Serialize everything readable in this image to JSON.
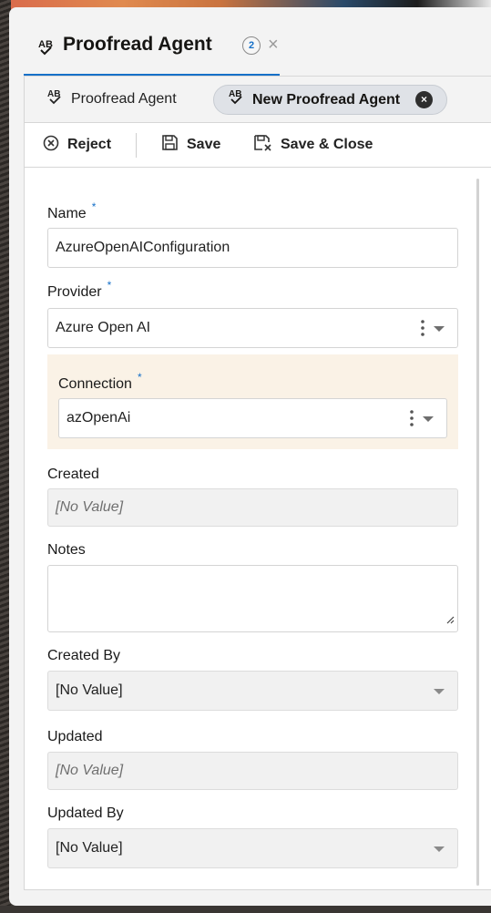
{
  "header": {
    "title": "Proofread Agent",
    "count": "2",
    "close_glyph": "×"
  },
  "subtabs": [
    {
      "label": "Proofread Agent"
    },
    {
      "label": "New Proofread Agent",
      "close_glyph": "×"
    }
  ],
  "toolbar": {
    "reject_label": "Reject",
    "save_label": "Save",
    "save_close_label": "Save & Close"
  },
  "form": {
    "name": {
      "label": "Name",
      "required_mark": "*",
      "value": "AzureOpenAIConfiguration"
    },
    "provider": {
      "label": "Provider",
      "required_mark": "*",
      "value": "Azure Open AI"
    },
    "connection": {
      "label": "Connection",
      "required_mark": "*",
      "value": "azOpenAi"
    },
    "created": {
      "label": "Created",
      "value": "[No Value]"
    },
    "notes": {
      "label": "Notes",
      "value": ""
    },
    "created_by": {
      "label": "Created By",
      "value": "[No Value]"
    },
    "updated": {
      "label": "Updated",
      "value": "[No Value]"
    },
    "updated_by": {
      "label": "Updated By",
      "value": "[No Value]"
    }
  },
  "colors": {
    "accent": "#1670c8",
    "connection_bg": "#faf2e6",
    "readonly_bg": "#f1f1f1"
  }
}
